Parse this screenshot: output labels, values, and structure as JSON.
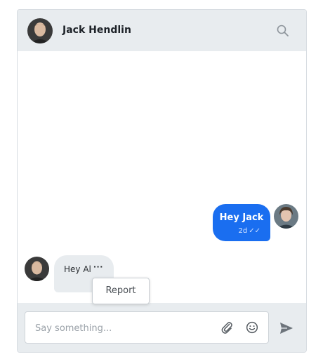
{
  "header": {
    "name": "Jack Hendlin",
    "search_icon": "search-icon"
  },
  "messages": {
    "outgoing": {
      "text": "Hey Jack",
      "time": "2d",
      "status": "✓✓"
    },
    "incoming": {
      "text": "Hey Al",
      "more": "···"
    }
  },
  "context_menu": {
    "report_label": "Report"
  },
  "composer": {
    "placeholder": "Say something...",
    "value": ""
  },
  "icons": {
    "attach": "paperclip-icon",
    "emoji": "smiley-icon",
    "send": "send-icon"
  },
  "colors": {
    "accent": "#1a6ef0",
    "header_bg": "#e8ecef",
    "bubble_in": "#e8ecef"
  }
}
